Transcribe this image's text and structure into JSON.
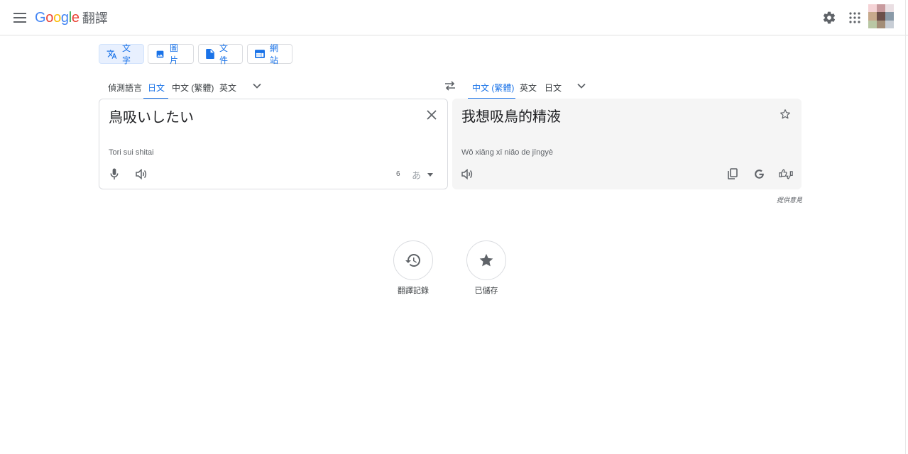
{
  "header": {
    "logo_letters": [
      {
        "ch": "G",
        "color": "#4285F4"
      },
      {
        "ch": "o",
        "color": "#EA4335"
      },
      {
        "ch": "o",
        "color": "#FBBC05"
      },
      {
        "ch": "g",
        "color": "#4285F4"
      },
      {
        "ch": "l",
        "color": "#34A853"
      },
      {
        "ch": "e",
        "color": "#EA4335"
      }
    ],
    "product": "翻譯",
    "icons": [
      "menu-icon",
      "settings-icon",
      "apps-icon"
    ],
    "avatar_colors": [
      "#f5d3d6",
      "#c89a9e",
      "#eadfe3",
      "#c7a98c",
      "#6b4f4a",
      "#8a9aa8",
      "#b9c7a4",
      "#a38d77",
      "#c8ced6"
    ]
  },
  "modes": [
    {
      "label": "文字",
      "icon": "translate-icon",
      "active": true
    },
    {
      "label": "圖片",
      "icon": "image-icon",
      "active": false
    },
    {
      "label": "文件",
      "icon": "document-icon",
      "active": false
    },
    {
      "label": "網站",
      "icon": "website-icon",
      "active": false
    }
  ],
  "source_langs": [
    "偵測語言",
    "日文",
    "中文 (繁體)",
    "英文"
  ],
  "source_selected": "日文",
  "target_langs": [
    "中文 (繁體)",
    "英文",
    "日文"
  ],
  "target_selected": "中文 (繁體)",
  "source": {
    "text": "鳥吸いしたい",
    "transliteration": "Tori sui shitai",
    "char_count": "6",
    "ime_label": "あ"
  },
  "target": {
    "text": "我想吸鳥的精液",
    "transliteration": "Wǒ xiǎng xī niǎo de jīngyè"
  },
  "feedback": "提供意見",
  "history_label": "翻譯記錄",
  "saved_label": "已儲存",
  "colors": {
    "accent": "#1a73e8",
    "icon": "#5f6368"
  }
}
